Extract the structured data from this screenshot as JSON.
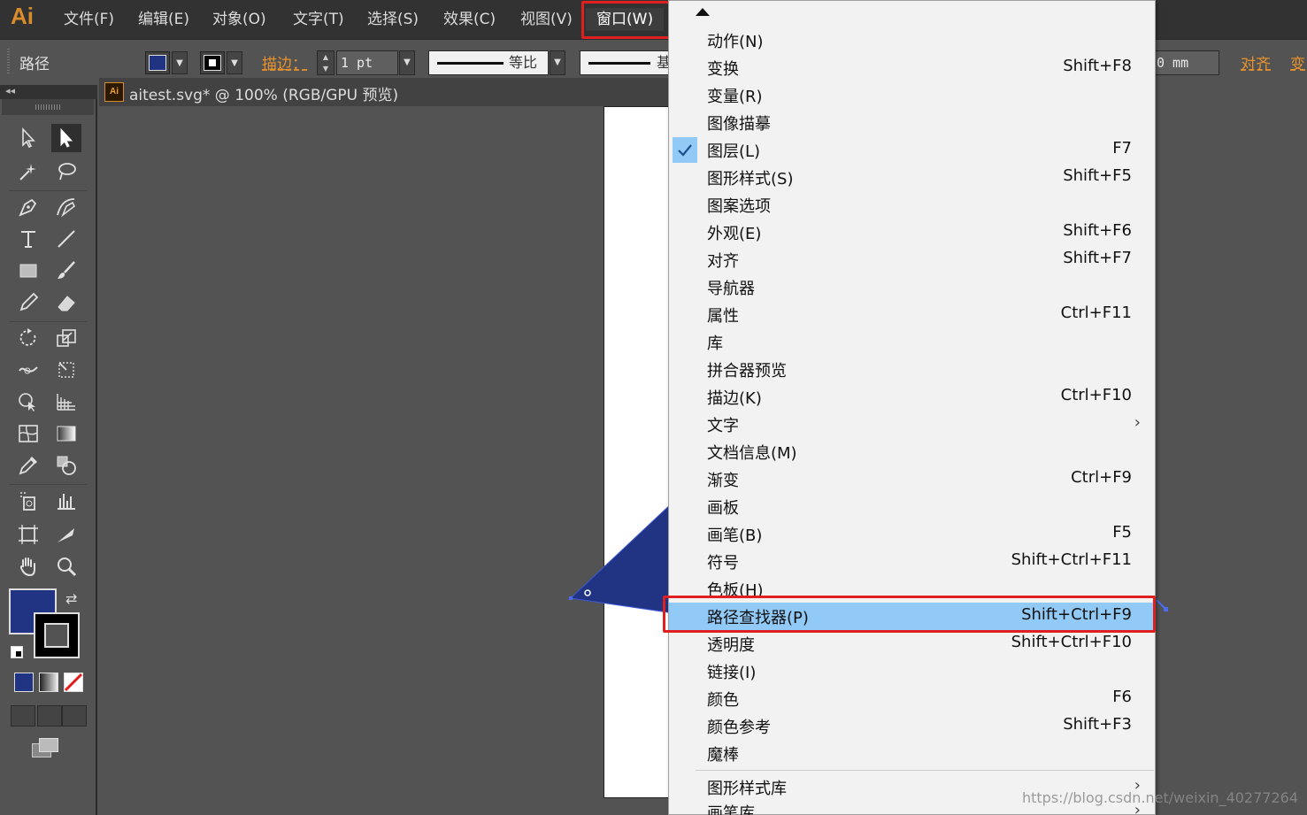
{
  "app": {
    "logo": "Ai",
    "menus": [
      "文件(F)",
      "编辑(E)",
      "对象(O)",
      "文字(T)",
      "选择(S)",
      "效果(C)",
      "视图(V)",
      "窗口(W)"
    ],
    "active_menu": "窗口(W)"
  },
  "control_bar": {
    "selection_label": "路径",
    "stroke_link": "描边：",
    "stroke_weight": "1 pt",
    "profile_label": "等比",
    "brush_label": "基",
    "position_value": "0 mm",
    "align_link": "对齐",
    "transform_link": "变"
  },
  "document": {
    "tab_title": "aitest.svg* @ 100% (RGB/GPU 预览)",
    "doc_icon": "Ai",
    "collapse": "◂◂"
  },
  "tools": {
    "fill_color": "#213483",
    "stroke_color": "#000000"
  },
  "window_menu": {
    "items": [
      {
        "label": "动作(N)",
        "shortcut": ""
      },
      {
        "label": "变换",
        "shortcut": "Shift+F8"
      },
      {
        "label": "变量(R)",
        "shortcut": ""
      },
      {
        "label": "图像描摹",
        "shortcut": ""
      },
      {
        "label": "图层(L)",
        "shortcut": "F7",
        "checked": true
      },
      {
        "label": "图形样式(S)",
        "shortcut": "Shift+F5"
      },
      {
        "label": "图案选项",
        "shortcut": ""
      },
      {
        "label": "外观(E)",
        "shortcut": "Shift+F6"
      },
      {
        "label": "对齐",
        "shortcut": "Shift+F7"
      },
      {
        "label": "导航器",
        "shortcut": ""
      },
      {
        "label": "属性",
        "shortcut": "Ctrl+F11"
      },
      {
        "label": "库",
        "shortcut": ""
      },
      {
        "label": "拼合器预览",
        "shortcut": ""
      },
      {
        "label": "描边(K)",
        "shortcut": "Ctrl+F10"
      },
      {
        "label": "文字",
        "shortcut": "",
        "submenu": true
      },
      {
        "label": "文档信息(M)",
        "shortcut": ""
      },
      {
        "label": "渐变",
        "shortcut": "Ctrl+F9"
      },
      {
        "label": "画板",
        "shortcut": ""
      },
      {
        "label": "画笔(B)",
        "shortcut": "F5"
      },
      {
        "label": "符号",
        "shortcut": "Shift+Ctrl+F11"
      },
      {
        "label": "色板(H)",
        "shortcut": ""
      },
      {
        "label": "路径查找器(P)",
        "shortcut": "Shift+Ctrl+F9",
        "highlighted": true
      },
      {
        "label": "透明度",
        "shortcut": "Shift+Ctrl+F10"
      },
      {
        "label": "链接(I)",
        "shortcut": ""
      },
      {
        "label": "颜色",
        "shortcut": "F6"
      },
      {
        "label": "颜色参考",
        "shortcut": "Shift+F3"
      },
      {
        "label": "魔棒",
        "shortcut": ""
      }
    ],
    "library_items": [
      {
        "label": "图形样式库",
        "submenu": true
      },
      {
        "label": "画笔库",
        "submenu": true
      }
    ]
  },
  "watermark": "https://blog.csdn.net/weixin_40277264",
  "colors": {
    "highlight": "#91c9f7",
    "annotation": "#e02020",
    "shape_fill": "#213483"
  }
}
